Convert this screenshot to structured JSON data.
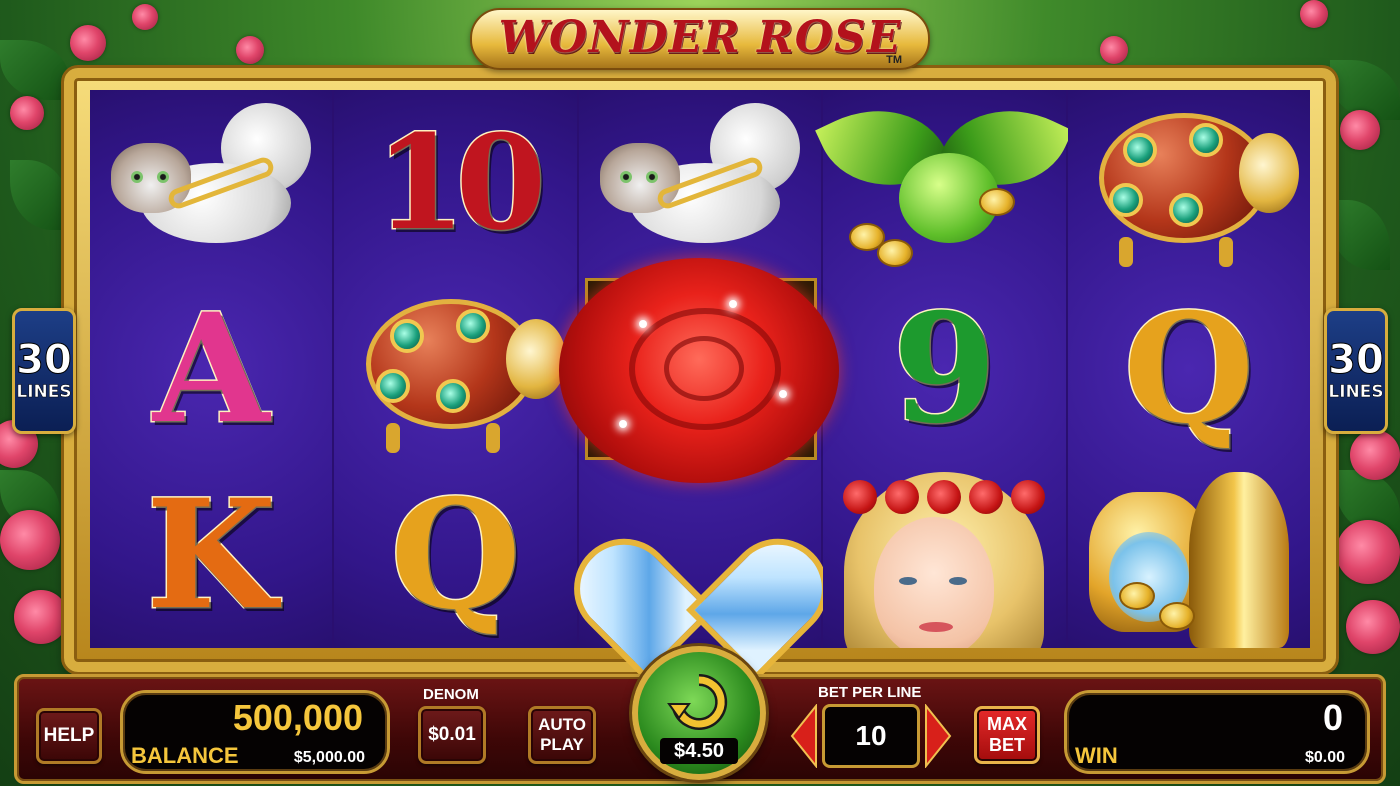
{
  "game": {
    "title": "WONDER ROSE",
    "trademark": "TM"
  },
  "paylines": {
    "count": "30",
    "label": "LINES"
  },
  "reels": [
    [
      "persian-cat",
      "A",
      "K"
    ],
    [
      "10",
      "jeweled-beetle",
      "Q"
    ],
    [
      "persian-cat",
      "red-rose",
      "diamond-heart"
    ],
    [
      "green-bird",
      "9",
      "rose-maiden"
    ],
    [
      "jeweled-beetle",
      "Q",
      "golden-statue"
    ]
  ],
  "controls": {
    "help_label": "HELP",
    "balance_credits": "500,000",
    "balance_label": "BALANCE",
    "balance_cash": "$5,000.00",
    "denom_title": "DENOM",
    "denom_value": "$0.01",
    "autoplay_line1": "AUTO",
    "autoplay_line2": "PLAY",
    "spin_cost": "$4.50",
    "bet_per_line_title": "BET PER LINE",
    "bet_per_line_value": "10",
    "maxbet_line1": "MAX",
    "maxbet_line2": "BET",
    "win_credits": "0",
    "win_label": "WIN",
    "win_cash": "$0.00"
  },
  "colors": {
    "reel_background": "#32168a",
    "frame_gold": "#d8ad3e",
    "bar_maroon": "#3e0707",
    "accent_yellow": "#f5c63c",
    "spin_green": "#2b8a1e"
  }
}
